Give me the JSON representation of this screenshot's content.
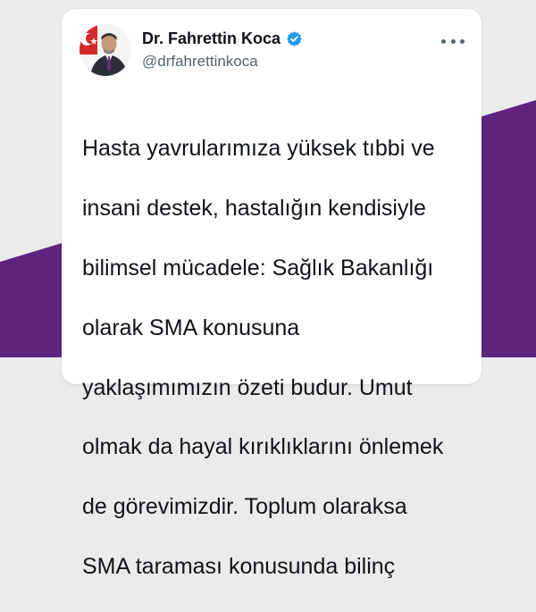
{
  "colors": {
    "background": "#ecebec",
    "band": "#5e2480",
    "card": "#ffffff",
    "name_text": "#0f1419",
    "handle_text": "#536471",
    "verified_badge": "#1d9bf0"
  },
  "tweet": {
    "author_name": "Dr. Fahrettin Koca",
    "author_handle": "@drfahrettinkoca",
    "verified_icon": "verified-badge-icon",
    "more_icon": "more-options-icon",
    "text_lines": [
      "Hasta yavrularımıza yüksek tıbbi ve",
      "insani destek, hastalığın kendisiyle",
      "bilimsel mücadele: Sağlık Bakanlığı",
      "olarak SMA konusuna",
      "yaklaşımımızın özeti budur. Umut",
      "olmak da hayal kırıklıklarını önlemek",
      "de görevimizdir. Toplum olaraksa",
      "SMA taraması konusunda bilinç"
    ]
  }
}
